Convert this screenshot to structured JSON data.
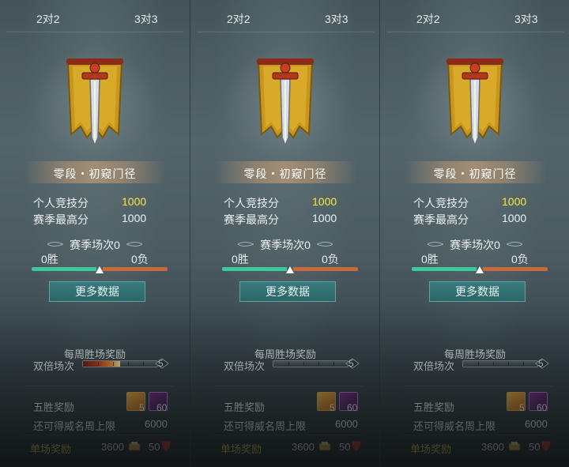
{
  "panels": [
    {
      "tabs": {
        "left": "2对2",
        "right": "3对3"
      },
      "active_tab": "none",
      "rank": "零段・初窥门径",
      "stats": {
        "personal_label": "个人竞技分",
        "personal_value": "1000",
        "season_high_label": "赛季最高分",
        "season_high_value": "1000"
      },
      "season": {
        "title": "赛季场次0",
        "wins": "0胜",
        "losses": "0负",
        "win_fraction": 0.5
      },
      "more_button": "更多数据",
      "weekly": {
        "title": "每周胜场奖励",
        "double_label": "双倍场次",
        "double_count": "5",
        "double_fill_fraction": 0.5
      },
      "rewards": {
        "five_win_label": "五胜奖励",
        "item_a_count": "5",
        "item_b_count": "60",
        "cap_label": "还可得威名周上限",
        "cap_value": "6000",
        "single_label": "单场奖励",
        "single_coin": "3600",
        "single_shield": "50"
      }
    },
    {
      "tabs": {
        "left": "2对2",
        "right": "3对3"
      },
      "active_tab": "right",
      "rank": "零段・初窥门径",
      "stats": {
        "personal_label": "个人竞技分",
        "personal_value": "1000",
        "season_high_label": "赛季最高分",
        "season_high_value": "1000"
      },
      "season": {
        "title": "赛季场次0",
        "wins": "0胜",
        "losses": "0负",
        "win_fraction": 0.5
      },
      "more_button": "更多数据",
      "weekly": {
        "title": "每周胜场奖励",
        "double_label": "双倍场次",
        "double_count": "5",
        "double_fill_fraction": 0.0
      },
      "rewards": {
        "five_win_label": "五胜奖励",
        "item_a_count": "5",
        "item_b_count": "60",
        "cap_label": "还可得威名周上限",
        "cap_value": "6000",
        "single_label": "单场奖励",
        "single_coin": "3600",
        "single_shield": "50"
      }
    },
    {
      "tabs": {
        "left": "2对2",
        "right": "3对3"
      },
      "active_tab": "none",
      "rank": "零段・初窥门径",
      "stats": {
        "personal_label": "个人竞技分",
        "personal_value": "1000",
        "season_high_label": "赛季最高分",
        "season_high_value": "1000"
      },
      "season": {
        "title": "赛季场次0",
        "wins": "0胜",
        "losses": "0负",
        "win_fraction": 0.5
      },
      "more_button": "更多数据",
      "weekly": {
        "title": "每周胜场奖励",
        "double_label": "双倍场次",
        "double_count": "5",
        "double_fill_fraction": 0.0
      },
      "rewards": {
        "five_win_label": "五胜奖励",
        "item_a_count": "5",
        "item_b_count": "60",
        "cap_label": "还可得威名周上限",
        "cap_value": "6000",
        "single_label": "单场奖励",
        "single_coin": "3600",
        "single_shield": "50"
      }
    }
  ],
  "colors": {
    "accent_gold": "#f6e84a",
    "win_green": "#3ec89a",
    "loss_orange": "#c9683a",
    "button_teal": "#2c6668"
  },
  "icons": {
    "emblem": "sword-banner-icon",
    "item_a": "gold-chest-icon",
    "item_b": "purple-gem-icon",
    "coin": "coin-icon",
    "shield": "red-shield-icon"
  }
}
